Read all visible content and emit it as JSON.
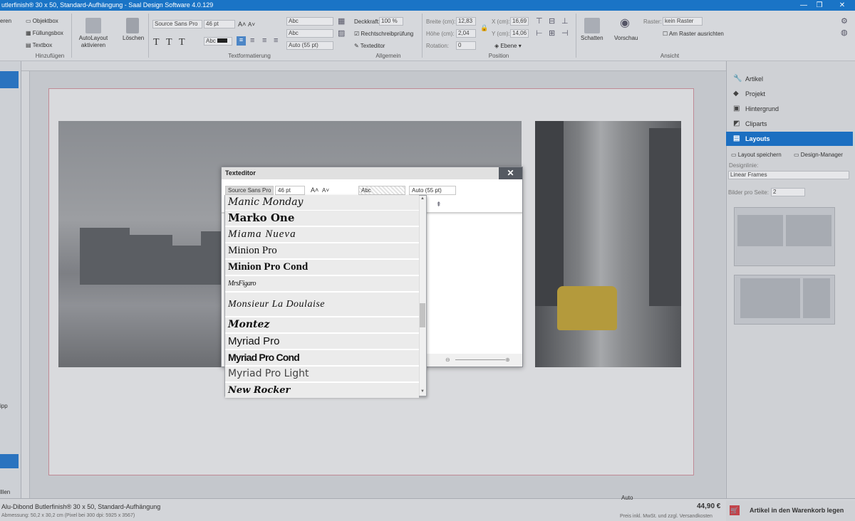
{
  "window": {
    "title": "utlerfinish® 30 x 50, Standard-Aufhängung - Saal Design Software 4.0.129",
    "minimize": "—",
    "maximize": "❐",
    "close": "✕"
  },
  "ribbon": {
    "hinzufuegen": {
      "label": "Hinzufügen",
      "items": [
        "Objektbox",
        "Füllungsbox",
        "Textbox"
      ],
      "left_cut_labels": [
        "eren"
      ]
    },
    "autolayout": "AutoLayout\naktivieren",
    "loeschen": "Löschen",
    "textformatierung": {
      "label": "Textformatierung",
      "font": "Source Sans Pro",
      "size": "46 pt",
      "grow": "A˄",
      "shrink": "A˅",
      "color_label": "Abc",
      "text_styles": [
        "T",
        "T",
        "T"
      ]
    },
    "allgemein": {
      "label": "Allgemein",
      "deckkraft_label": "Deckkraft:",
      "deckkraft_value": "100 %",
      "spacing": "Auto (55 pt)",
      "spellcheck": "Rechtschreibprüfung",
      "texteditor": "Texteditor",
      "abc1": "Abc",
      "abc2": "Abc"
    },
    "position": {
      "label": "Position",
      "breite_label": "Breite (cm):",
      "breite_value": "12,83",
      "hoehe_label": "Höhe (cm):",
      "hoehe_value": "2,04",
      "rotation_label": "Rotation:",
      "rotation_value": "0",
      "x_label": "X (cm):",
      "x_value": "16,69",
      "y_label": "Y (cm):",
      "y_value": "14,06",
      "ebene": "Ebene"
    },
    "schatten": "Schatten",
    "vorschau": "Vorschau",
    "ansicht": {
      "label": "Ansicht",
      "raster_label": "Raster:",
      "raster_value": "kein Raster",
      "am_raster": "Am Raster ausrichten"
    }
  },
  "left_panel": {
    "cut_labels": [
      "lllen",
      "ipp"
    ]
  },
  "right_panel": {
    "items": [
      {
        "label": "Artikel",
        "icon": "wrench-icon",
        "glyph": "🔧"
      },
      {
        "label": "Projekt",
        "icon": "cube-icon",
        "glyph": "◆"
      },
      {
        "label": "Hintergrund",
        "icon": "background-icon",
        "glyph": "▣"
      },
      {
        "label": "Cliparts",
        "icon": "clipart-icon",
        "glyph": "◩"
      },
      {
        "label": "Layouts",
        "icon": "layouts-icon",
        "glyph": "▤"
      }
    ],
    "layout_speichern": "Layout speichern",
    "design_manager": "Design-Manager",
    "designlinie_label": "Designlinie:",
    "designlinie_value": "Linear Frames",
    "bilder_label": "Bilder pro Seite:",
    "bilder_value": "2"
  },
  "status": {
    "product": "Alu-Dibond Butlerfinish® 30 x 50, Standard-Aufhängung",
    "abmessung": "Abmessung: 50,2 x 30,2 cm (Pixel bei 300 dpi: 5925 x 3567)",
    "zoom": "Auto",
    "price": "44,90 €",
    "price_note": "Preis inkl. MwSt. und zzgl. Versandkosten",
    "cart": "Artikel in den Warenkorb legen"
  },
  "dialog": {
    "title": "Texteditor",
    "close": "✕",
    "font": "Source Sans Pro",
    "size": "46 pt",
    "grow": "A˄",
    "shrink": "A˅",
    "color_label": "Abc",
    "spacing": "Auto (55 pt)"
  },
  "font_list": [
    "Manic Monday",
    "Marko One",
    "Miama Nueva",
    "Minion Pro",
    "Minion Pro Cond",
    "MrsFigaro",
    "Monsieur La Doulaise",
    "Montez",
    "Myriad Pro",
    "Myriad Pro Cond",
    "Myriad Pro Light",
    "New Rocker"
  ]
}
